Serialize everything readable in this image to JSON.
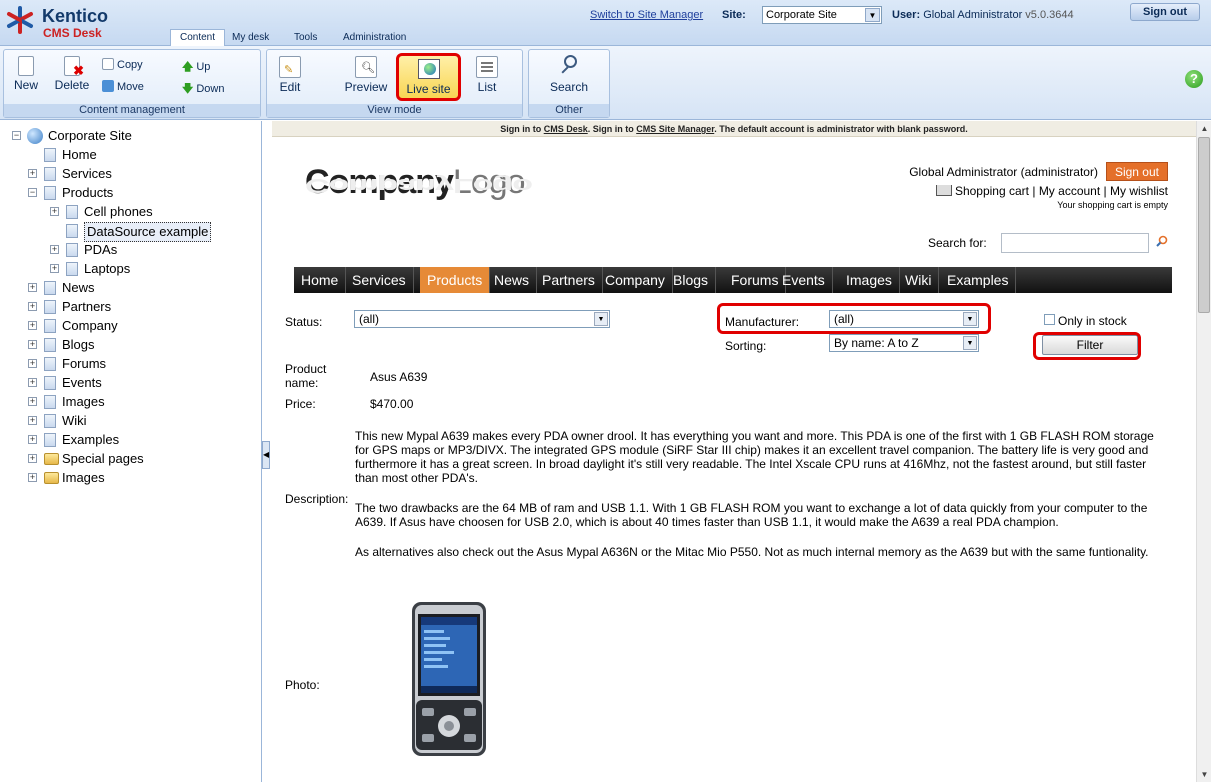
{
  "app": {
    "logo_line1": "Kentico",
    "logo_line2": "CMS Desk",
    "tabs": [
      "Content",
      "My desk",
      "Tools",
      "Administration"
    ],
    "switch_link": "Switch to Site Manager",
    "site_label": "Site:",
    "site_value": "Corporate Site",
    "user_label": "User:",
    "user_value": "Global Administrator",
    "version": "v5.0.3644",
    "signout": "Sign out"
  },
  "toolbar": {
    "content_group": {
      "caption": "Content management",
      "new": "New",
      "delete": "Delete",
      "copy": "Copy",
      "move": "Move",
      "up": "Up",
      "down": "Down"
    },
    "view_group": {
      "caption": "View mode",
      "edit": "Edit",
      "preview": "Preview",
      "live_site": "Live site",
      "list": "List"
    },
    "other_group": {
      "caption": "Other",
      "search": "Search"
    }
  },
  "tree": {
    "root": "Corporate Site",
    "items": [
      "Home",
      "Services",
      "Products",
      "Cell phones",
      "DataSource example",
      "PDAs",
      "Laptops",
      "News",
      "Partners",
      "Company",
      "Blogs",
      "Forums",
      "Events",
      "Images",
      "Wiki",
      "Examples",
      "Special pages",
      "Images"
    ]
  },
  "site": {
    "info_pre": "Sign in to ",
    "info_cms": "CMS Desk",
    "info_mid": ". Sign in to ",
    "info_sm": "CMS Site Manager",
    "info_post": ". The default account is administrator with blank password.",
    "logo_a": "Company",
    "logo_b": "Logo",
    "logo_reflection": "CompanyLogo",
    "user_line": "Global Administrator (administrator)",
    "signout": "Sign out",
    "cart": "Shopping cart",
    "sep": "|",
    "my_account": "My account",
    "my_wishlist": "My wishlist",
    "cart_empty": "Your shopping cart is empty",
    "search_label": "Search for:",
    "menu": [
      "Home",
      "Services",
      "Products",
      "News",
      "Partners",
      "Company",
      "Blogs",
      "Forums",
      "Events",
      "Images",
      "Wiki",
      "Examples"
    ],
    "filter": {
      "status_label": "Status:",
      "status_value": "(all)",
      "manufacturer_label": "Manufacturer:",
      "manufacturer_value": "(all)",
      "sorting_label": "Sorting:",
      "sorting_value": "By name: A to Z",
      "only_in_stock": "Only in stock",
      "filter_button": "Filter"
    },
    "product": {
      "name_label": "Product name:",
      "name_value": "Asus A639",
      "price_label": "Price:",
      "price_value": "$470.00",
      "description_label": "Description:",
      "desc_p1": "This new Mypal A639 makes every PDA owner drool. It has everything you want and more. This PDA is one of the first with 1 GB FLASH ROM storage for GPS maps or MP3/DIVX. The integrated GPS module (SiRF Star III chip) makes it an excellent travel companion. The battery life is very good and furthermore it has a great screen. In broad daylight it's still very readable. The Intel Xscale CPU runs at 416Mhz, not the fastest around, but still faster than most other PDA's.",
      "desc_p2": "The two drawbacks are the 64 MB of ram and USB 1.1. With 1 GB FLASH ROM you want to exchange a lot of data quickly from your computer to the A639. If Asus have choosen for USB 2.0, which is about 40 times faster than USB 1.1, it would make the A639 a real PDA champion.",
      "desc_p3": "As alternatives also check out the Asus Mypal A636N or the Mitac Mio P550. Not as much internal memory as the A639 but with the same funtionality.",
      "photo_label": "Photo:"
    }
  },
  "colors": {
    "highlight": "#e00000",
    "menu_active": "#e68a37",
    "signout_bg": "#e4702a"
  }
}
